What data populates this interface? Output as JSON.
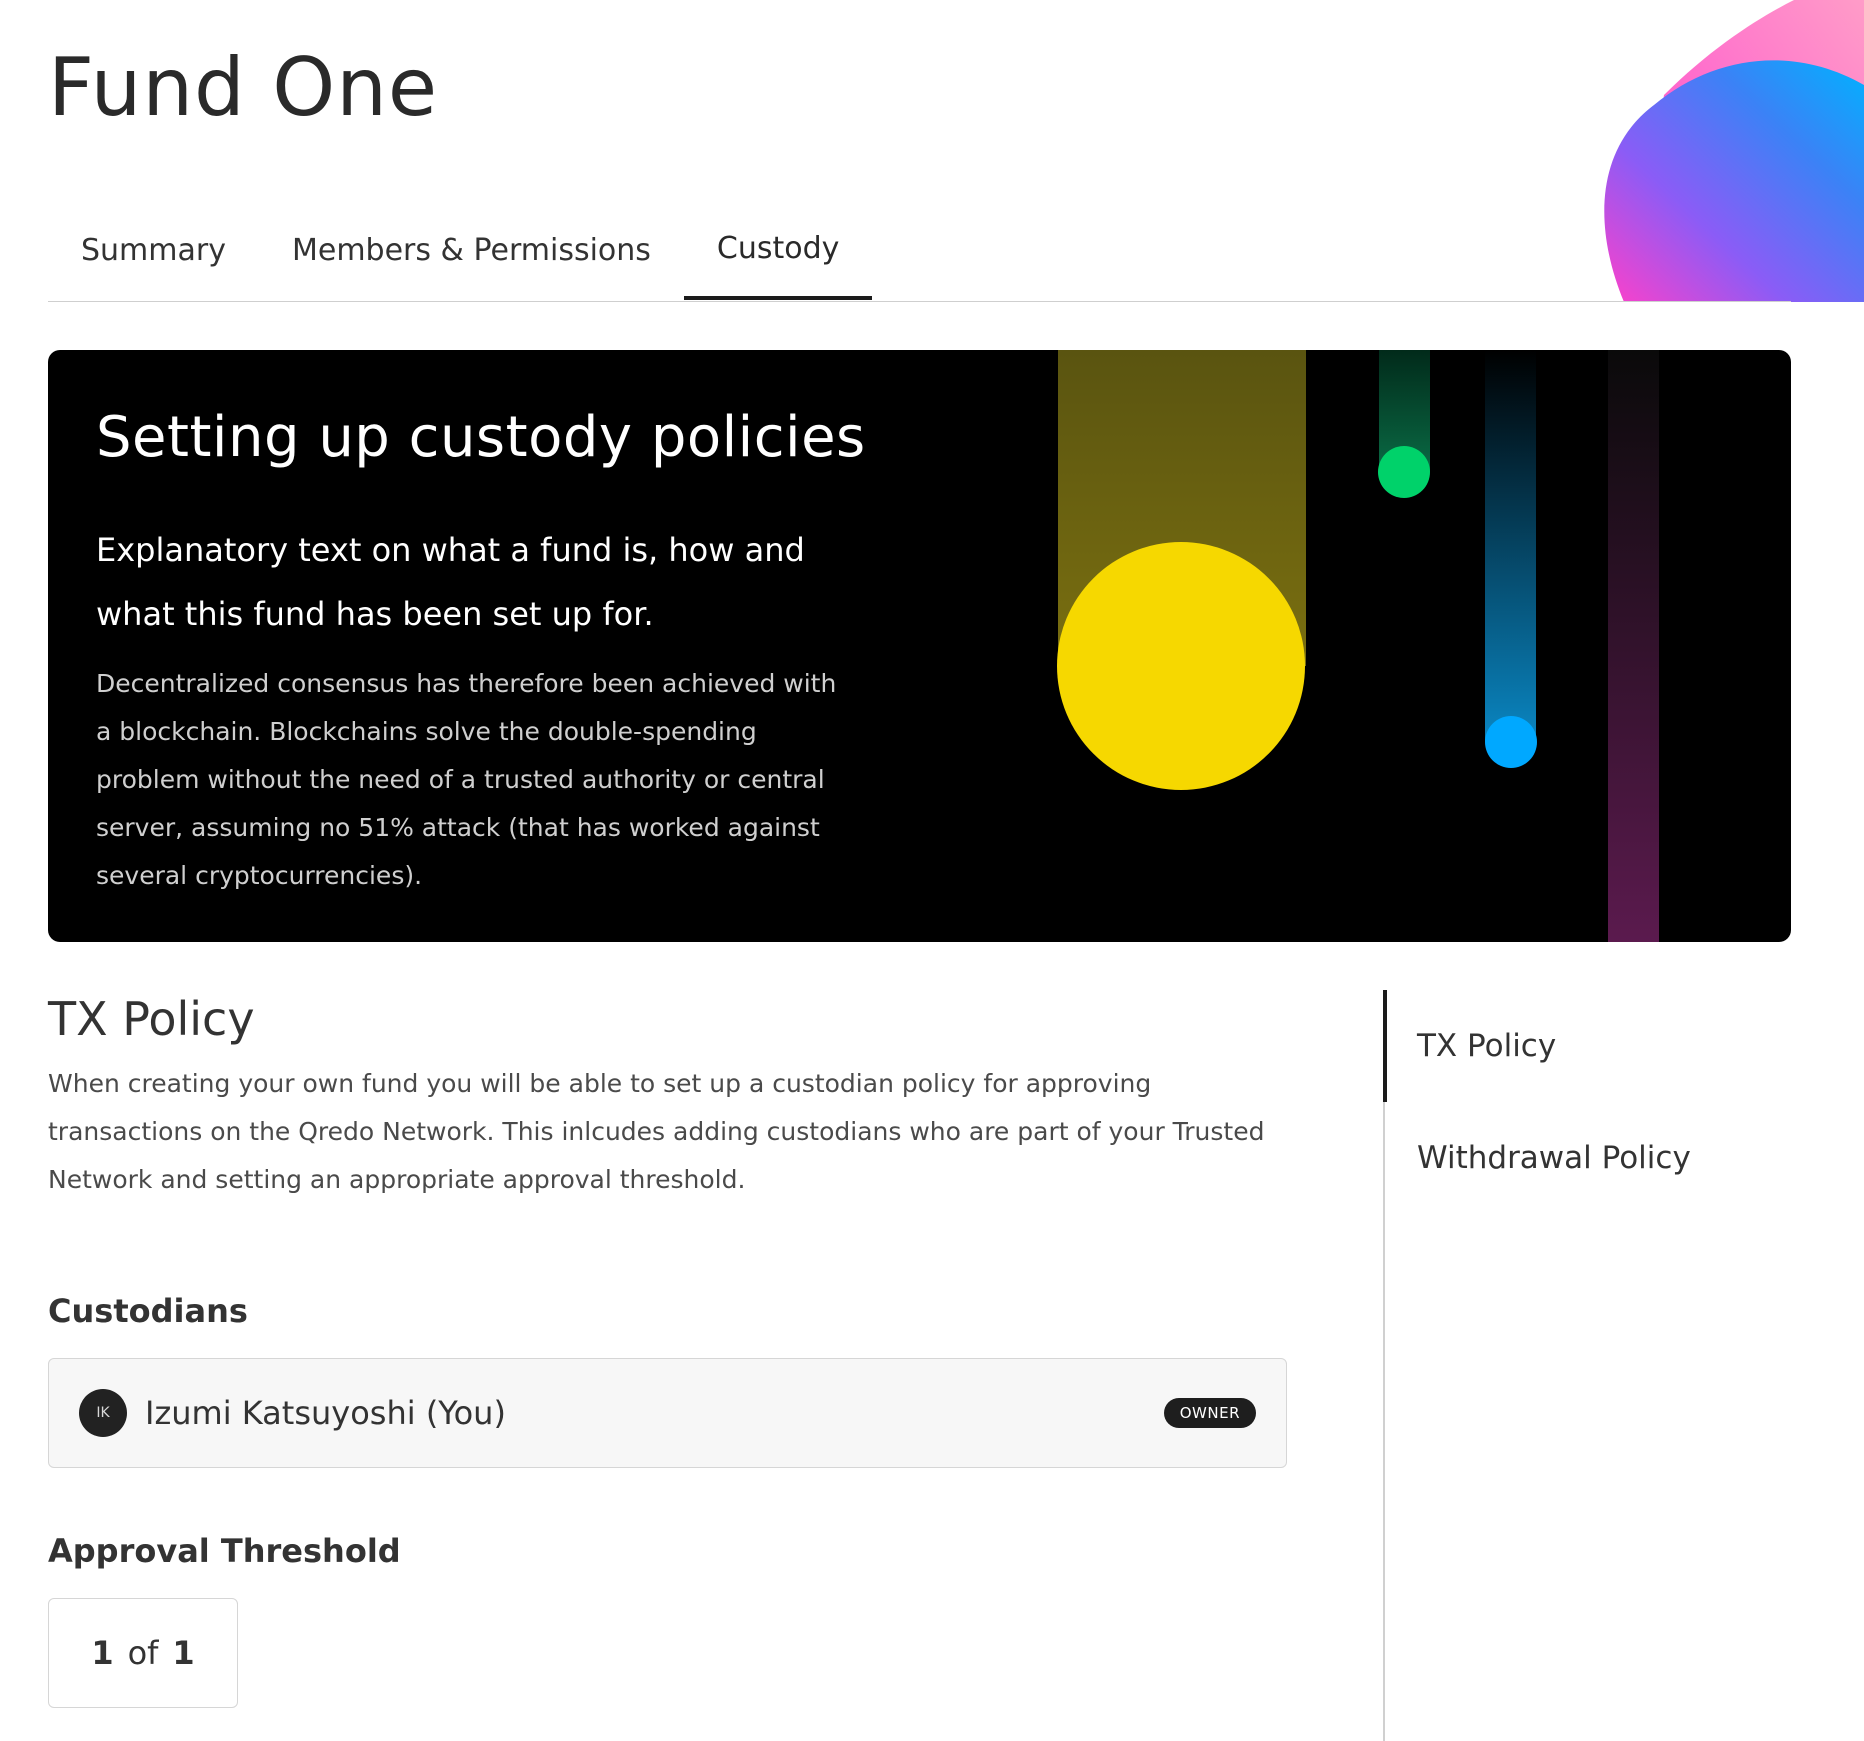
{
  "page": {
    "title": "Fund One"
  },
  "tabs": [
    {
      "label": "Summary",
      "active": false
    },
    {
      "label": "Members & Permissions",
      "active": false
    },
    {
      "label": "Custody",
      "active": true
    }
  ],
  "banner": {
    "title": "Setting up custody policies",
    "lead": "Explanatory text on what a fund is, how and what this fund has been set up for.",
    "body": "Decentralized consensus has therefore been achieved with a blockchain. Blockchains solve the double-spending problem without the need of a trusted authority or central server, assuming no 51% attack (that has worked against several cryptocurrencies).",
    "colors": {
      "yellow": "#f6d800",
      "green": "#00d26a",
      "blue": "#00a8ff",
      "magenta": "#c23ab0"
    }
  },
  "tx_policy": {
    "title": "TX Policy",
    "description": "When creating your own fund you will be able to set up a custodian policy for approving transactions on the Qredo Network. This inlcudes adding custodians who are part of your Trusted Network and setting an appropriate approval threshold.",
    "custodians_title": "Custodians",
    "custodians": [
      {
        "initials": "IK",
        "name": "Izumi Katsuyoshi (You)",
        "role": "OWNER"
      }
    ],
    "threshold_title": "Approval Threshold",
    "threshold": {
      "required": "1",
      "separator": "of",
      "total": "1"
    }
  },
  "side_nav": {
    "items": [
      {
        "label": "TX Policy",
        "active": true
      },
      {
        "label": "Withdrawal Policy",
        "active": false
      }
    ]
  }
}
